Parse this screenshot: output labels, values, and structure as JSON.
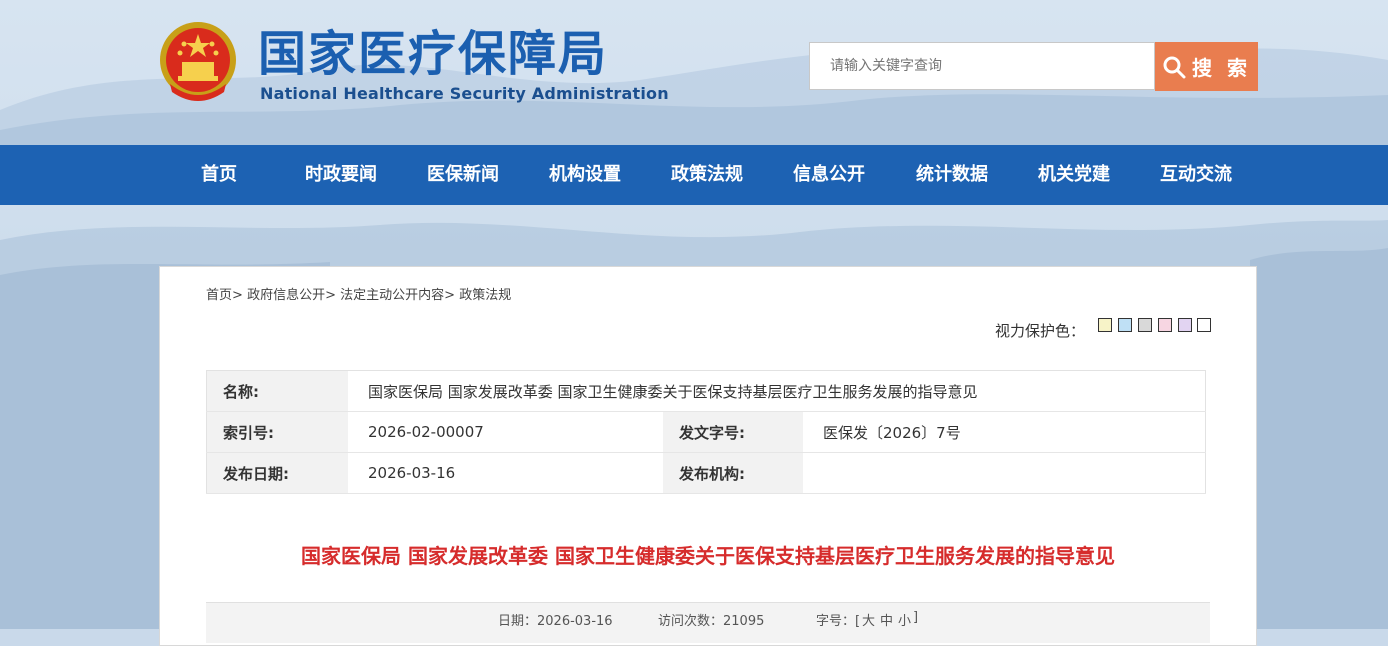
{
  "header": {
    "site_name_cn": "国家医疗保障局",
    "site_name_en": "National Healthcare Security Administration",
    "emblem_icon": "national-emblem-icon"
  },
  "search": {
    "placeholder": "请输入关键字查询",
    "button_label": "搜 索",
    "button_color": "#e97d4f"
  },
  "nav": {
    "color": "#1d62b3",
    "items": [
      "首页",
      "时政要闻",
      "医保新闻",
      "机构设置",
      "政策法规",
      "信息公开",
      "统计数据",
      "机关党建",
      "互动交流"
    ]
  },
  "breadcrumb": {
    "items": [
      "首页",
      "政府信息公开",
      "法定主动公开内容",
      "政策法规"
    ],
    "separator": ">"
  },
  "eye_protection": {
    "label": "视力保护色：",
    "colors": [
      "#f7f3c8",
      "#bfe0f5",
      "#d9d9d9",
      "#f7d6e2",
      "#e2d4f2",
      "#ffffff"
    ]
  },
  "info": {
    "name_label": "名称:",
    "name_value": "国家医保局 国家发展改革委 国家卫生健康委关于医保支持基层医疗卫生服务发展的指导意见",
    "index_label": "索引号:",
    "index_value": "2026-02-00007",
    "doc_no_label": "发文字号:",
    "doc_no_value": "医保发〔2026〕7号",
    "date_label": "发布日期:",
    "date_value": "2026-03-16",
    "org_label": "发布机构:",
    "org_value": ""
  },
  "article": {
    "title": "国家医保局 国家发展改革委 国家卫生健康委关于医保支持基层医疗卫生服务发展的指导意见",
    "title_color": "#d62c2c",
    "date_text": "日期：2026-03-16",
    "visits_text": "访问次数：21095",
    "fontsize_label": "字号：[",
    "font_large": "大",
    "font_medium": "中",
    "font_small": "小",
    "fontsize_close": "]"
  }
}
